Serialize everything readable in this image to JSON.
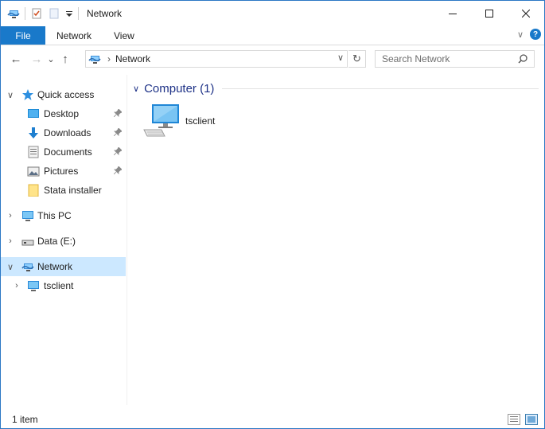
{
  "window": {
    "title": "Network"
  },
  "titlebar": {
    "quick_access_icons": [
      "network-icon",
      "properties-icon",
      "new-folder-icon",
      "customize-dropdown-icon"
    ],
    "minimize": "—",
    "maximize": "☐",
    "close": "✕"
  },
  "ribbon": {
    "tabs": [
      {
        "label": "File"
      },
      {
        "label": "Network"
      },
      {
        "label": "View"
      }
    ],
    "expand_glyph": "∨",
    "help_glyph": "?"
  },
  "nav": {
    "back": "←",
    "forward": "→",
    "recent": "⌄",
    "up": "↑",
    "address": {
      "crumbs": [
        "Network"
      ],
      "separator": "›",
      "dropdown": "∨",
      "refresh": "↻"
    },
    "search": {
      "placeholder": "Search Network"
    }
  },
  "navpane": {
    "items": [
      {
        "label": "Quick access",
        "icon": "star-icon",
        "expanded": true
      },
      {
        "label": "Desktop",
        "icon": "desktop-folder-icon",
        "pinned": true
      },
      {
        "label": "Downloads",
        "icon": "downloads-icon",
        "pinned": true
      },
      {
        "label": "Documents",
        "icon": "documents-icon",
        "pinned": true
      },
      {
        "label": "Pictures",
        "icon": "pictures-icon",
        "pinned": true
      },
      {
        "label": "Stata installer",
        "icon": "folder-icon",
        "pinned": false
      },
      {
        "label": "This PC",
        "icon": "computer-icon",
        "expanded": false
      },
      {
        "label": "Data (E:)",
        "icon": "drive-icon",
        "expanded": false
      },
      {
        "label": "Network",
        "icon": "network-icon",
        "expanded": true,
        "selected": true
      },
      {
        "label": "tsclient",
        "icon": "computer-icon",
        "expanded": false
      }
    ],
    "pin_glyph": "📌",
    "chevron_collapsed": "›",
    "chevron_expanded": "∨"
  },
  "content": {
    "group": {
      "title": "Computer (1)"
    },
    "items": [
      {
        "name": "tsclient",
        "icon": "computer-icon"
      }
    ]
  },
  "status": {
    "count": "1 item"
  },
  "colors": {
    "accent": "#1979ca",
    "selection": "#cce8ff",
    "group_title": "#1e3287"
  }
}
